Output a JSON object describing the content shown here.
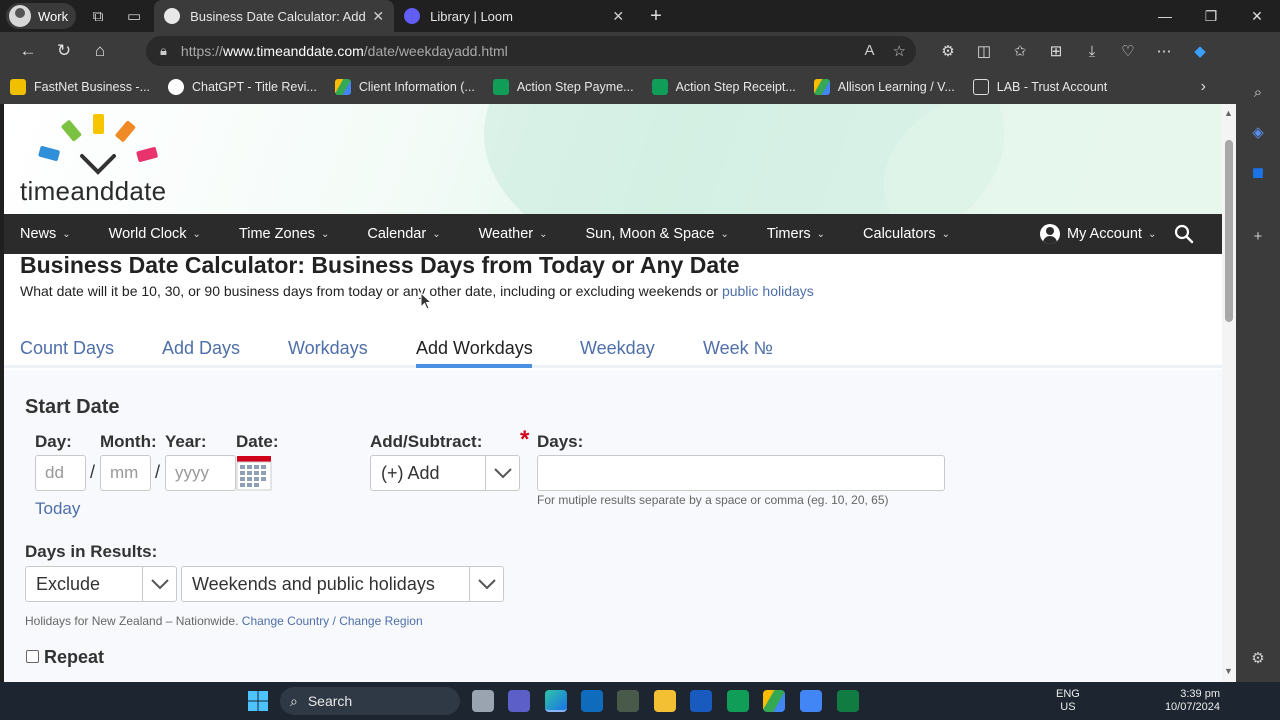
{
  "browser": {
    "profile_label": "Work",
    "tabs": [
      {
        "title": "Business Date Calculator: Add/Su",
        "active": true
      },
      {
        "title": "Library | Loom",
        "active": false
      }
    ],
    "url_protocol": "https://",
    "url_host": "www.timeanddate.com",
    "url_path": "/date/weekdayadd.html",
    "bookmarks": [
      {
        "label": "FastNet Business -...",
        "icon": "fastnet-icon",
        "color": "#f0c000"
      },
      {
        "label": "ChatGPT - Title Revi...",
        "icon": "chatgpt-icon",
        "color": "#ffffff"
      },
      {
        "label": "Client Information (...",
        "icon": "google-drive-icon",
        "color": "#34a853"
      },
      {
        "label": "Action Step Payme...",
        "icon": "google-sheets-icon",
        "color": "#0f9d58"
      },
      {
        "label": "Action Step Receipt...",
        "icon": "google-sheets-icon",
        "color": "#0f9d58"
      },
      {
        "label": "Allison Learning / V...",
        "icon": "google-drive-icon",
        "color": "#34a853"
      },
      {
        "label": "LAB - Trust Account",
        "icon": "page-icon",
        "color": "#dddddd"
      }
    ]
  },
  "site": {
    "logo_text": "timeanddate",
    "menu": [
      "News",
      "World Clock",
      "Time Zones",
      "Calendar",
      "Weather",
      "Sun, Moon & Space",
      "Timers",
      "Calculators"
    ],
    "account_label": "My Account",
    "title": "Business Date Calculator: Business Days from Today or Any Date",
    "subtitle": "What date will it be 10, 30, or 90 business days from today or any other date, including or excluding weekends or ",
    "subtitle_link": "public holidays",
    "calc_tabs": [
      "Count Days",
      "Add Days",
      "Workdays",
      "Add Workdays",
      "Weekday",
      "Week №"
    ],
    "selected_tab": "Add Workdays"
  },
  "form": {
    "section_title": "Start Date",
    "day_label": "Day:",
    "month_label": "Month:",
    "year_label": "Year:",
    "date_label": "Date:",
    "day_placeholder": "dd",
    "month_placeholder": "mm",
    "year_placeholder": "yyyy",
    "separator": "/",
    "today_link": "Today",
    "addsub_label": "Add/Subtract:",
    "addsub_value": "(+) Add",
    "days_label": "Days:",
    "days_value": "",
    "days_hint": "For mutiple results separate by a space or comma (eg. 10, 20, 65)",
    "results_label": "Days in Results:",
    "exclude_value": "Exclude",
    "holidays_value": "Weekends and public holidays",
    "holidays_note": "Holidays for New Zealand – Nationwide.",
    "change_country": "Change Country",
    "change_region": "Change Region",
    "region_separator": "/",
    "repeat_label": "Repeat",
    "repeat_checked": false
  },
  "taskbar": {
    "search_label": "Search",
    "lang_top": "ENG",
    "lang_bottom": "US",
    "time": "3:39 pm",
    "date": "10/07/2024"
  },
  "colors": {
    "link": "#4e6fa8",
    "tab_underline": "#4a90e2",
    "required": "#d0021b",
    "menu_bg": "#2b2b2b"
  }
}
